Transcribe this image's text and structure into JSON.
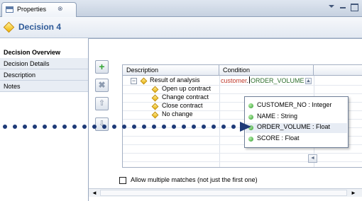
{
  "view": {
    "tab_label": "Properties",
    "close_glyph": "⊗"
  },
  "form": {
    "title": "Decision 4"
  },
  "sidebar": {
    "items": [
      {
        "label": "Decision Overview",
        "active": true
      },
      {
        "label": "Decision Details",
        "active": false
      },
      {
        "label": "Description",
        "active": false
      },
      {
        "label": "Notes",
        "active": false
      }
    ]
  },
  "buttons": {
    "add_glyph": "+",
    "remove_glyph": "✖",
    "up_glyph": "⇧",
    "down_glyph": "⇩"
  },
  "table": {
    "headers": {
      "description": "Description",
      "condition": "Condition"
    },
    "root": {
      "toggle": "−",
      "label": "Result of analysis"
    },
    "rows": [
      "Open up contract",
      "Change contract",
      "Close contract",
      "No change"
    ],
    "condition": {
      "variable": "customer",
      "separator": ".",
      "property": "ORDER_VOLUME"
    }
  },
  "autocomplete": {
    "items": [
      "CUSTOMER_NO : Integer",
      "NAME : String",
      "ORDER_VOLUME : Float",
      "SCORE : Float"
    ],
    "selected_index": 2
  },
  "options": {
    "allow_multiple_label": "Allow multiple matches (not just the first one)",
    "allow_multiple_checked": false
  },
  "colors": {
    "accent": "#2e5a98",
    "callout": "#1e3a78",
    "variable": "#c0392b",
    "property": "#2d6e2d"
  },
  "icons": [
    "properties-view-icon",
    "decision-diamond-icon",
    "add-icon",
    "delete-icon",
    "move-up-icon",
    "move-down-icon",
    "attribute-dot-icon"
  ]
}
